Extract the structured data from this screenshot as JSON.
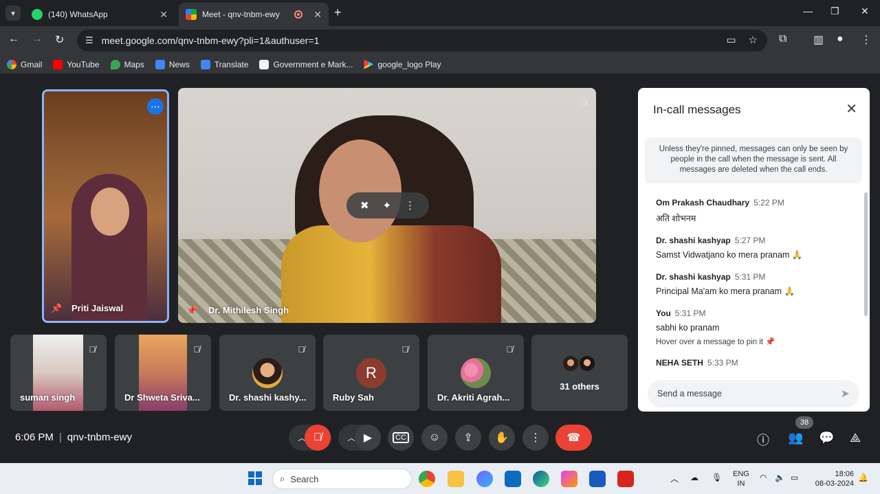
{
  "browser": {
    "tabs": [
      {
        "title": "(140) WhatsApp",
        "active": false
      },
      {
        "title": "Meet - qnv-tnbm-ewy",
        "active": true
      }
    ],
    "url": "meet.google.com/qnv-tnbm-ewy?pli=1&authuser=1",
    "bookmarks": [
      "Gmail",
      "YouTube",
      "Maps",
      "News",
      "Translate",
      "Government e Mark...",
      "google_logo Play"
    ]
  },
  "meet": {
    "participants_main": [
      {
        "name": "Priti Jaiswal",
        "pinned": true
      },
      {
        "name": "Dr. Mithilesh Singh",
        "pinned": true
      }
    ],
    "participants_strip": [
      {
        "name": "suman singh",
        "kind": "video"
      },
      {
        "name": "Dr Shweta Sriva...",
        "kind": "video"
      },
      {
        "name": "Dr. shashi kashy...",
        "kind": "photo"
      },
      {
        "name": "Ruby Sah",
        "kind": "initial",
        "initial": "R",
        "color": "#8d3b2f"
      },
      {
        "name": "Dr. Akriti Agrah...",
        "kind": "photo"
      }
    ],
    "others_label": "31 others",
    "time": "6:06 PM",
    "meeting_code": "qnv-tnbm-ewy",
    "people_count": "38",
    "accent": "#1a73e8",
    "end_call_color": "#ea4335"
  },
  "chat": {
    "title": "In-call messages",
    "notice": "Unless they're pinned, messages can only be seen by people in the call when the message is sent. All messages are deleted when the call ends.",
    "messages": [
      {
        "sender": "Om Prakash Chaudhary",
        "time": "5:22 PM",
        "text": "अति शोभनम"
      },
      {
        "sender": "Dr. shashi kashyap",
        "time": "5:27 PM",
        "text": "Samst Vidwatjano ko mera pranam 🙏"
      },
      {
        "sender": "Dr. shashi kashyap",
        "time": "5:31 PM",
        "text": "Principal Ma'am ko mera pranam 🙏"
      },
      {
        "sender": "You",
        "time": "5:31 PM",
        "text": "sabhi ko pranam",
        "hint": "Hover over a message to pin it"
      },
      {
        "sender": "NEHA SETH",
        "time": "5:33 PM",
        "text": ""
      }
    ],
    "placeholder": "Send a message"
  },
  "taskbar": {
    "search_label": "Search",
    "lang_line1": "ENG",
    "lang_line2": "IN",
    "time": "18:06",
    "date": "08-03-2024"
  }
}
